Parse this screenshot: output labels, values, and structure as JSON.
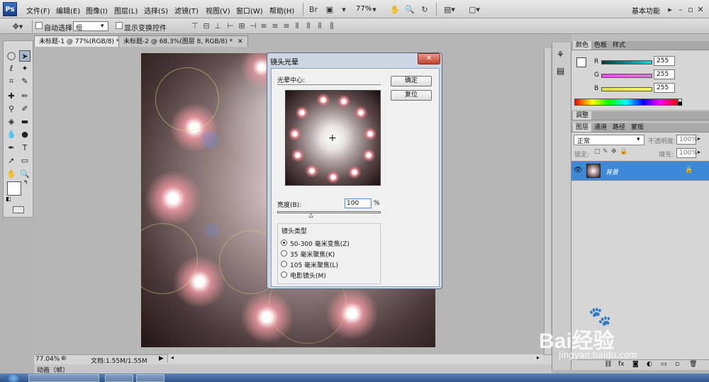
{
  "app": {
    "logo": "Ps"
  },
  "menus": [
    "文件(F)",
    "编辑(E)",
    "图像(I)",
    "图层(L)",
    "选择(S)",
    "滤镜(T)",
    "视图(V)",
    "窗口(W)",
    "帮助(H)"
  ],
  "toolbar": {
    "zoom": "77%",
    "workspace": "基本功能"
  },
  "options": {
    "auto_select": "自动选择:",
    "group_value": "组",
    "show_transform": "显示变换控件"
  },
  "tabs": [
    {
      "label": "未标题-1 @ 77%(RGB/8) *",
      "active": true
    },
    {
      "label": "未标题-2 @ 68.3%(图层 8, RGB/8) *",
      "active": false
    }
  ],
  "status": {
    "zoom": "77.04%",
    "doc": "文档:1.55M/1.55M",
    "anim": "动画（帧）"
  },
  "color_panel": {
    "tabs": [
      "颜色",
      "色板",
      "样式"
    ],
    "channels": [
      {
        "label": "R",
        "value": "255",
        "color": "#00c0c0"
      },
      {
        "label": "G",
        "value": "255",
        "color": "#d040d0"
      },
      {
        "label": "B",
        "value": "255",
        "color": "#e0e040"
      }
    ]
  },
  "adjust_panel": {
    "tab": "调整"
  },
  "layers_panel": {
    "tabs": [
      "图层",
      "通道",
      "路径",
      "蒙版"
    ],
    "blend_mode": "正常",
    "opacity_label": "不透明度:",
    "opacity": "100%",
    "lock_label": "锁定:",
    "fill_label": "填充:",
    "fill": "100%",
    "layer_name": "背景"
  },
  "dialog": {
    "title": "镜头光晕",
    "center_label": "光晕中心:",
    "ok": "确定",
    "reset": "复位",
    "brightness_label": "亮度(B):",
    "brightness_value": "100",
    "percent": "%",
    "brightness_level": 1.0,
    "lens_type_label": "镜头类型",
    "lens_options": [
      {
        "label": "50-300 毫米变焦(Z)",
        "checked": true
      },
      {
        "label": "35 毫米聚焦(K)",
        "checked": false
      },
      {
        "label": "105 毫米聚焦(L)",
        "checked": false
      },
      {
        "label": "电影镜头(M)",
        "checked": false
      }
    ]
  },
  "watermark": {
    "brand": "Bai经验",
    "url": "jingyan.baidu.com"
  }
}
